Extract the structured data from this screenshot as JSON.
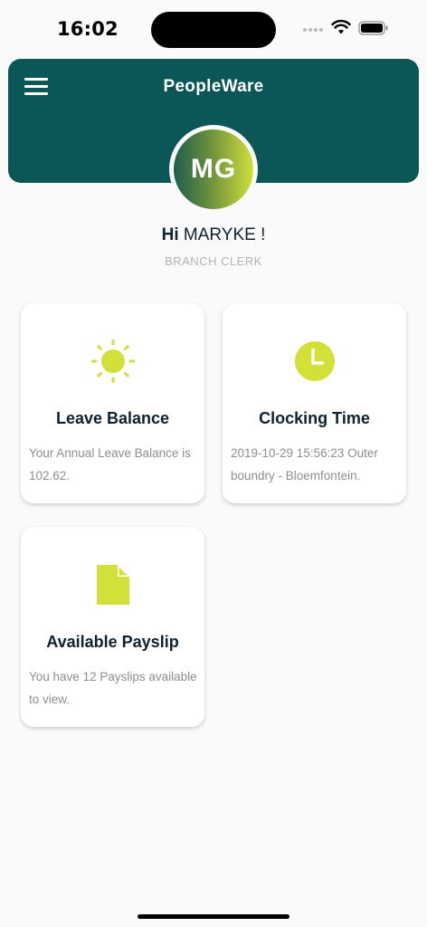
{
  "status_bar": {
    "time": "16:02"
  },
  "header": {
    "title": "PeopleWare",
    "menu_icon": "hamburger-menu-icon"
  },
  "profile": {
    "initials": "MG",
    "greeting_prefix": "Hi",
    "name": "MARYKE !",
    "role": "BRANCH CLERK"
  },
  "cards": [
    {
      "icon": "sun-icon",
      "title": "Leave Balance",
      "description": "Your Annual Leave Balance is 102.62."
    },
    {
      "icon": "clock-icon",
      "title": "Clocking Time",
      "description": "2019-10-29 15:56:23 Outer boundry - Bloemfontein."
    },
    {
      "icon": "document-icon",
      "title": "Available Payslip",
      "description": "You have 12 Payslips available to view."
    }
  ],
  "colors": {
    "header_bg": "#0b5656",
    "accent": "#d4e03a",
    "background": "#fafafa"
  }
}
